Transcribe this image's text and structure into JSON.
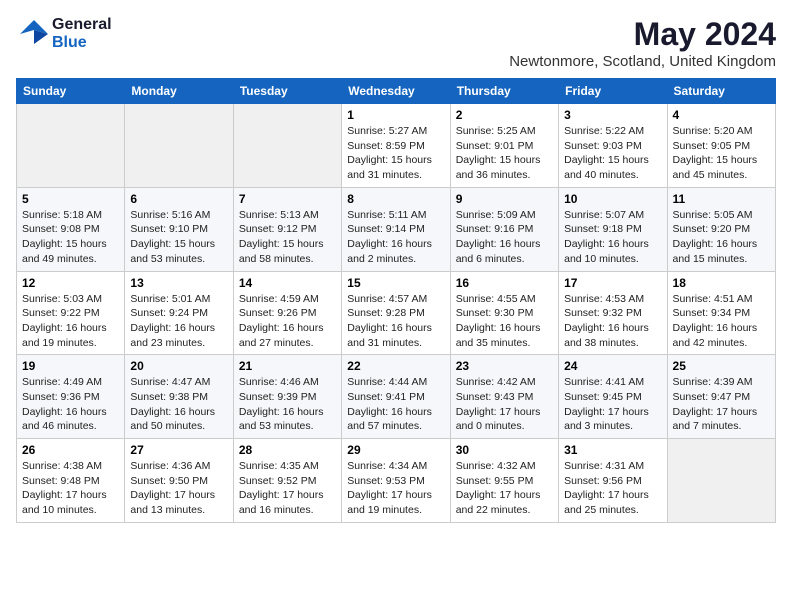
{
  "logo": {
    "general": "General",
    "blue": "Blue"
  },
  "title": "May 2024",
  "location": "Newtonmore, Scotland, United Kingdom",
  "days_of_week": [
    "Sunday",
    "Monday",
    "Tuesday",
    "Wednesday",
    "Thursday",
    "Friday",
    "Saturday"
  ],
  "weeks": [
    [
      {
        "day": "",
        "content": ""
      },
      {
        "day": "",
        "content": ""
      },
      {
        "day": "",
        "content": ""
      },
      {
        "day": "1",
        "content": "Sunrise: 5:27 AM\nSunset: 8:59 PM\nDaylight: 15 hours\nand 31 minutes."
      },
      {
        "day": "2",
        "content": "Sunrise: 5:25 AM\nSunset: 9:01 PM\nDaylight: 15 hours\nand 36 minutes."
      },
      {
        "day": "3",
        "content": "Sunrise: 5:22 AM\nSunset: 9:03 PM\nDaylight: 15 hours\nand 40 minutes."
      },
      {
        "day": "4",
        "content": "Sunrise: 5:20 AM\nSunset: 9:05 PM\nDaylight: 15 hours\nand 45 minutes."
      }
    ],
    [
      {
        "day": "5",
        "content": "Sunrise: 5:18 AM\nSunset: 9:08 PM\nDaylight: 15 hours\nand 49 minutes."
      },
      {
        "day": "6",
        "content": "Sunrise: 5:16 AM\nSunset: 9:10 PM\nDaylight: 15 hours\nand 53 minutes."
      },
      {
        "day": "7",
        "content": "Sunrise: 5:13 AM\nSunset: 9:12 PM\nDaylight: 15 hours\nand 58 minutes."
      },
      {
        "day": "8",
        "content": "Sunrise: 5:11 AM\nSunset: 9:14 PM\nDaylight: 16 hours\nand 2 minutes."
      },
      {
        "day": "9",
        "content": "Sunrise: 5:09 AM\nSunset: 9:16 PM\nDaylight: 16 hours\nand 6 minutes."
      },
      {
        "day": "10",
        "content": "Sunrise: 5:07 AM\nSunset: 9:18 PM\nDaylight: 16 hours\nand 10 minutes."
      },
      {
        "day": "11",
        "content": "Sunrise: 5:05 AM\nSunset: 9:20 PM\nDaylight: 16 hours\nand 15 minutes."
      }
    ],
    [
      {
        "day": "12",
        "content": "Sunrise: 5:03 AM\nSunset: 9:22 PM\nDaylight: 16 hours\nand 19 minutes."
      },
      {
        "day": "13",
        "content": "Sunrise: 5:01 AM\nSunset: 9:24 PM\nDaylight: 16 hours\nand 23 minutes."
      },
      {
        "day": "14",
        "content": "Sunrise: 4:59 AM\nSunset: 9:26 PM\nDaylight: 16 hours\nand 27 minutes."
      },
      {
        "day": "15",
        "content": "Sunrise: 4:57 AM\nSunset: 9:28 PM\nDaylight: 16 hours\nand 31 minutes."
      },
      {
        "day": "16",
        "content": "Sunrise: 4:55 AM\nSunset: 9:30 PM\nDaylight: 16 hours\nand 35 minutes."
      },
      {
        "day": "17",
        "content": "Sunrise: 4:53 AM\nSunset: 9:32 PM\nDaylight: 16 hours\nand 38 minutes."
      },
      {
        "day": "18",
        "content": "Sunrise: 4:51 AM\nSunset: 9:34 PM\nDaylight: 16 hours\nand 42 minutes."
      }
    ],
    [
      {
        "day": "19",
        "content": "Sunrise: 4:49 AM\nSunset: 9:36 PM\nDaylight: 16 hours\nand 46 minutes."
      },
      {
        "day": "20",
        "content": "Sunrise: 4:47 AM\nSunset: 9:38 PM\nDaylight: 16 hours\nand 50 minutes."
      },
      {
        "day": "21",
        "content": "Sunrise: 4:46 AM\nSunset: 9:39 PM\nDaylight: 16 hours\nand 53 minutes."
      },
      {
        "day": "22",
        "content": "Sunrise: 4:44 AM\nSunset: 9:41 PM\nDaylight: 16 hours\nand 57 minutes."
      },
      {
        "day": "23",
        "content": "Sunrise: 4:42 AM\nSunset: 9:43 PM\nDaylight: 17 hours\nand 0 minutes."
      },
      {
        "day": "24",
        "content": "Sunrise: 4:41 AM\nSunset: 9:45 PM\nDaylight: 17 hours\nand 3 minutes."
      },
      {
        "day": "25",
        "content": "Sunrise: 4:39 AM\nSunset: 9:47 PM\nDaylight: 17 hours\nand 7 minutes."
      }
    ],
    [
      {
        "day": "26",
        "content": "Sunrise: 4:38 AM\nSunset: 9:48 PM\nDaylight: 17 hours\nand 10 minutes."
      },
      {
        "day": "27",
        "content": "Sunrise: 4:36 AM\nSunset: 9:50 PM\nDaylight: 17 hours\nand 13 minutes."
      },
      {
        "day": "28",
        "content": "Sunrise: 4:35 AM\nSunset: 9:52 PM\nDaylight: 17 hours\nand 16 minutes."
      },
      {
        "day": "29",
        "content": "Sunrise: 4:34 AM\nSunset: 9:53 PM\nDaylight: 17 hours\nand 19 minutes."
      },
      {
        "day": "30",
        "content": "Sunrise: 4:32 AM\nSunset: 9:55 PM\nDaylight: 17 hours\nand 22 minutes."
      },
      {
        "day": "31",
        "content": "Sunrise: 4:31 AM\nSunset: 9:56 PM\nDaylight: 17 hours\nand 25 minutes."
      },
      {
        "day": "",
        "content": ""
      }
    ]
  ]
}
